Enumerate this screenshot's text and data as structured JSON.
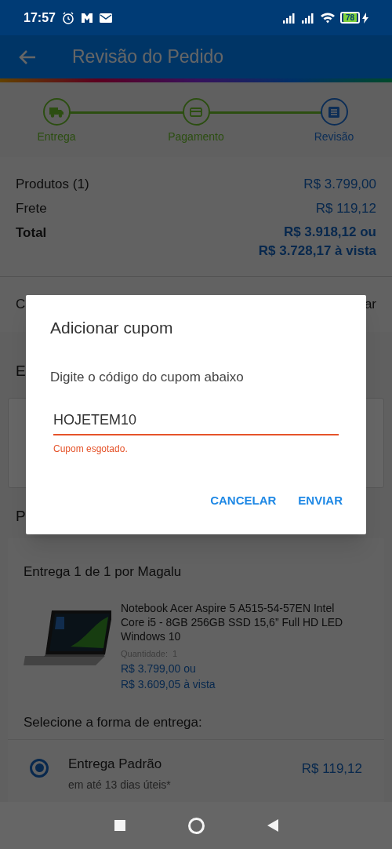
{
  "status_bar": {
    "time": "17:57",
    "battery": "78"
  },
  "header": {
    "title": "Revisão do Pedido"
  },
  "steps": [
    {
      "label": "Entrega",
      "current": false
    },
    {
      "label": "Pagamento",
      "current": false
    },
    {
      "label": "Revisão",
      "current": true
    }
  ],
  "summary": {
    "rows": [
      {
        "label": "Produtos (1)",
        "value": "R$ 3.799,00"
      },
      {
        "label": "Frete",
        "value": "R$ 119,12"
      }
    ],
    "total": {
      "label": "Total",
      "value": "R$ 3.918,12 ou",
      "cash_value": "R$ 3.728,17 à vista"
    }
  },
  "coupon_row": {
    "label": "C",
    "action": "ar"
  },
  "section_1": {
    "title": "E"
  },
  "section_2": {
    "title": "P"
  },
  "delivery": {
    "title": "Entrega 1 de 1 por Magalu",
    "product": {
      "name": "Notebook Acer Aspire 5 A515-54-57EN Intel Core i5 - 8GB 256GB SSD 15,6” Full HD LED Windows 10",
      "quantity_label": "Quantidade:",
      "quantity": "1",
      "price": "R$ 3.799,00 ou",
      "cash_price": "R$ 3.609,05 à vista"
    },
    "options_title": "Selecione a forma de entrega:",
    "options": [
      {
        "name": "Entrega Padrão",
        "eta": "em até 13 dias úteis*",
        "price": "R$ 119,12",
        "selected": true
      }
    ]
  },
  "dialog": {
    "title": "Adicionar cupom",
    "message": "Digite o código do cupom abaixo",
    "value": "HOJETEM10",
    "error": "Cupom esgotado.",
    "buttons": [
      "CANCELAR",
      "ENVIAR"
    ]
  }
}
